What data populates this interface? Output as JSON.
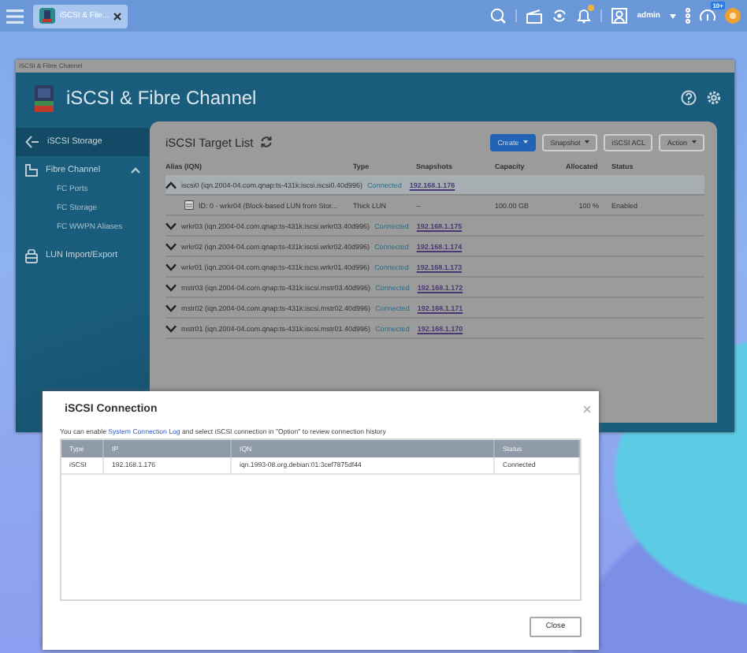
{
  "taskbar": {
    "app_tab": {
      "label": "iSCSI & File...",
      "selected": true
    },
    "user": "admin",
    "info_badge": "10+"
  },
  "main_window": {
    "title": "iSCSI & Fibre Channel",
    "app_title": "iSCSI & Fibre Channel",
    "sidebar": {
      "items": [
        {
          "label": "iSCSI Storage",
          "kind": "iscsi",
          "selected": true
        },
        {
          "label": "Fibre Channel",
          "kind": "fc",
          "selected": false,
          "expanded": true,
          "children": [
            {
              "label": "FC Ports",
              "selected": false
            },
            {
              "label": "FC Storage",
              "selected": false
            },
            {
              "label": "FC WWPN Aliases",
              "selected": false
            }
          ]
        },
        {
          "label": "LUN Import/Export",
          "kind": "lun",
          "selected": false
        }
      ]
    },
    "target_list": {
      "title": "iSCSI Target List",
      "buttons": [
        {
          "label": "Create",
          "kind": "primary",
          "dropdown": true
        },
        {
          "label": "Snapshot",
          "kind": "default",
          "dropdown": true
        },
        {
          "label": "iSCSI ACL",
          "kind": "default",
          "dropdown": false
        },
        {
          "label": "Action",
          "kind": "default",
          "dropdown": true
        }
      ],
      "columns": [
        "Alias (IQN)",
        "Type",
        "Snapshots",
        "Capacity",
        "Allocated",
        "Status"
      ],
      "rows": [
        {
          "alias": "iscsi0 (iqn.2004-04.com.qnap:ts-431k:iscsi.iscsi0.40d996)",
          "status": "Connected",
          "ip": "192.168.1.176",
          "expanded": true,
          "luns": [
            {
              "name": "ID: 0 - wrkr04 (Block-based LUN from Stor...",
              "type": "Thick LUN",
              "snapshots": "--",
              "capacity": "100.00 GB",
              "allocated": "100 %",
              "status": "Enabled"
            }
          ]
        },
        {
          "alias": "wrkr03 (iqn.2004-04.com.qnap:ts-431k:iscsi.wrkr03.40d996)",
          "status": "Connected",
          "ip": "192.168.1.175",
          "expanded": false
        },
        {
          "alias": "wrkr02 (iqn.2004-04.com.qnap:ts-431k:iscsi.wrkr02.40d996)",
          "status": "Connected",
          "ip": "192.168.1.174",
          "expanded": false
        },
        {
          "alias": "wrkr01 (iqn.2004-04.com.qnap:ts-431k:iscsi.wrkr01.40d996)",
          "status": "Connected",
          "ip": "192.168.1.173",
          "expanded": false
        },
        {
          "alias": "mstr03 (iqn.2004-04.com.qnap:ts-431k:iscsi.mstr03.40d996)",
          "status": "Connected",
          "ip": "192.168.1.172",
          "expanded": false
        },
        {
          "alias": "mstr02 (iqn.2004-04.com.qnap:ts-431k:iscsi.mstr02.40d996)",
          "status": "Connected",
          "ip": "192.168.1.171",
          "expanded": false
        },
        {
          "alias": "mstr01 (iqn.2004-04.com.qnap:ts-431k:iscsi.mstr01.40d996)",
          "status": "Connected",
          "ip": "192.168.1.170",
          "expanded": false
        }
      ]
    }
  },
  "dialog": {
    "title": "iSCSI Connection",
    "message": {
      "before": "You can enable ",
      "link": "System Connection Log",
      "after": " and select iSCSI connection in \"Option\" to review connection history"
    },
    "columns": [
      "Type",
      "IP",
      "IQN",
      "Status"
    ],
    "rows": [
      [
        "iSCSI",
        "192.168.1.176",
        "iqn.1993-08.org.debian:01:3cef7875df44",
        "Connected"
      ]
    ],
    "close_button": "Close"
  }
}
